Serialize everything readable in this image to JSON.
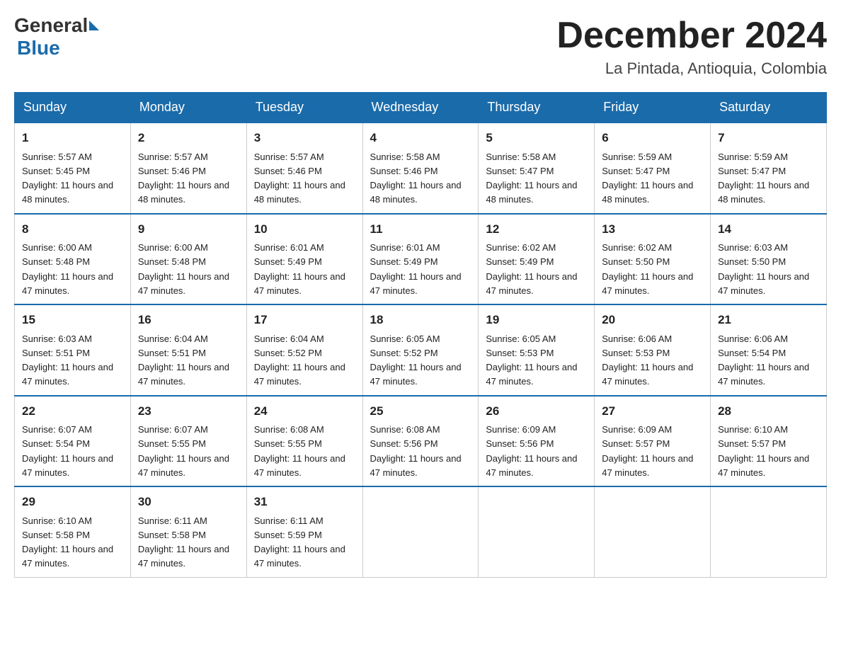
{
  "header": {
    "logo_general": "General",
    "logo_blue": "Blue",
    "month_title": "December 2024",
    "location": "La Pintada, Antioquia, Colombia"
  },
  "days_of_week": [
    "Sunday",
    "Monday",
    "Tuesday",
    "Wednesday",
    "Thursday",
    "Friday",
    "Saturday"
  ],
  "weeks": [
    [
      {
        "day": "1",
        "sunrise": "Sunrise: 5:57 AM",
        "sunset": "Sunset: 5:45 PM",
        "daylight": "Daylight: 11 hours and 48 minutes."
      },
      {
        "day": "2",
        "sunrise": "Sunrise: 5:57 AM",
        "sunset": "Sunset: 5:46 PM",
        "daylight": "Daylight: 11 hours and 48 minutes."
      },
      {
        "day": "3",
        "sunrise": "Sunrise: 5:57 AM",
        "sunset": "Sunset: 5:46 PM",
        "daylight": "Daylight: 11 hours and 48 minutes."
      },
      {
        "day": "4",
        "sunrise": "Sunrise: 5:58 AM",
        "sunset": "Sunset: 5:46 PM",
        "daylight": "Daylight: 11 hours and 48 minutes."
      },
      {
        "day": "5",
        "sunrise": "Sunrise: 5:58 AM",
        "sunset": "Sunset: 5:47 PM",
        "daylight": "Daylight: 11 hours and 48 minutes."
      },
      {
        "day": "6",
        "sunrise": "Sunrise: 5:59 AM",
        "sunset": "Sunset: 5:47 PM",
        "daylight": "Daylight: 11 hours and 48 minutes."
      },
      {
        "day": "7",
        "sunrise": "Sunrise: 5:59 AM",
        "sunset": "Sunset: 5:47 PM",
        "daylight": "Daylight: 11 hours and 48 minutes."
      }
    ],
    [
      {
        "day": "8",
        "sunrise": "Sunrise: 6:00 AM",
        "sunset": "Sunset: 5:48 PM",
        "daylight": "Daylight: 11 hours and 47 minutes."
      },
      {
        "day": "9",
        "sunrise": "Sunrise: 6:00 AM",
        "sunset": "Sunset: 5:48 PM",
        "daylight": "Daylight: 11 hours and 47 minutes."
      },
      {
        "day": "10",
        "sunrise": "Sunrise: 6:01 AM",
        "sunset": "Sunset: 5:49 PM",
        "daylight": "Daylight: 11 hours and 47 minutes."
      },
      {
        "day": "11",
        "sunrise": "Sunrise: 6:01 AM",
        "sunset": "Sunset: 5:49 PM",
        "daylight": "Daylight: 11 hours and 47 minutes."
      },
      {
        "day": "12",
        "sunrise": "Sunrise: 6:02 AM",
        "sunset": "Sunset: 5:49 PM",
        "daylight": "Daylight: 11 hours and 47 minutes."
      },
      {
        "day": "13",
        "sunrise": "Sunrise: 6:02 AM",
        "sunset": "Sunset: 5:50 PM",
        "daylight": "Daylight: 11 hours and 47 minutes."
      },
      {
        "day": "14",
        "sunrise": "Sunrise: 6:03 AM",
        "sunset": "Sunset: 5:50 PM",
        "daylight": "Daylight: 11 hours and 47 minutes."
      }
    ],
    [
      {
        "day": "15",
        "sunrise": "Sunrise: 6:03 AM",
        "sunset": "Sunset: 5:51 PM",
        "daylight": "Daylight: 11 hours and 47 minutes."
      },
      {
        "day": "16",
        "sunrise": "Sunrise: 6:04 AM",
        "sunset": "Sunset: 5:51 PM",
        "daylight": "Daylight: 11 hours and 47 minutes."
      },
      {
        "day": "17",
        "sunrise": "Sunrise: 6:04 AM",
        "sunset": "Sunset: 5:52 PM",
        "daylight": "Daylight: 11 hours and 47 minutes."
      },
      {
        "day": "18",
        "sunrise": "Sunrise: 6:05 AM",
        "sunset": "Sunset: 5:52 PM",
        "daylight": "Daylight: 11 hours and 47 minutes."
      },
      {
        "day": "19",
        "sunrise": "Sunrise: 6:05 AM",
        "sunset": "Sunset: 5:53 PM",
        "daylight": "Daylight: 11 hours and 47 minutes."
      },
      {
        "day": "20",
        "sunrise": "Sunrise: 6:06 AM",
        "sunset": "Sunset: 5:53 PM",
        "daylight": "Daylight: 11 hours and 47 minutes."
      },
      {
        "day": "21",
        "sunrise": "Sunrise: 6:06 AM",
        "sunset": "Sunset: 5:54 PM",
        "daylight": "Daylight: 11 hours and 47 minutes."
      }
    ],
    [
      {
        "day": "22",
        "sunrise": "Sunrise: 6:07 AM",
        "sunset": "Sunset: 5:54 PM",
        "daylight": "Daylight: 11 hours and 47 minutes."
      },
      {
        "day": "23",
        "sunrise": "Sunrise: 6:07 AM",
        "sunset": "Sunset: 5:55 PM",
        "daylight": "Daylight: 11 hours and 47 minutes."
      },
      {
        "day": "24",
        "sunrise": "Sunrise: 6:08 AM",
        "sunset": "Sunset: 5:55 PM",
        "daylight": "Daylight: 11 hours and 47 minutes."
      },
      {
        "day": "25",
        "sunrise": "Sunrise: 6:08 AM",
        "sunset": "Sunset: 5:56 PM",
        "daylight": "Daylight: 11 hours and 47 minutes."
      },
      {
        "day": "26",
        "sunrise": "Sunrise: 6:09 AM",
        "sunset": "Sunset: 5:56 PM",
        "daylight": "Daylight: 11 hours and 47 minutes."
      },
      {
        "day": "27",
        "sunrise": "Sunrise: 6:09 AM",
        "sunset": "Sunset: 5:57 PM",
        "daylight": "Daylight: 11 hours and 47 minutes."
      },
      {
        "day": "28",
        "sunrise": "Sunrise: 6:10 AM",
        "sunset": "Sunset: 5:57 PM",
        "daylight": "Daylight: 11 hours and 47 minutes."
      }
    ],
    [
      {
        "day": "29",
        "sunrise": "Sunrise: 6:10 AM",
        "sunset": "Sunset: 5:58 PM",
        "daylight": "Daylight: 11 hours and 47 minutes."
      },
      {
        "day": "30",
        "sunrise": "Sunrise: 6:11 AM",
        "sunset": "Sunset: 5:58 PM",
        "daylight": "Daylight: 11 hours and 47 minutes."
      },
      {
        "day": "31",
        "sunrise": "Sunrise: 6:11 AM",
        "sunset": "Sunset: 5:59 PM",
        "daylight": "Daylight: 11 hours and 47 minutes."
      },
      null,
      null,
      null,
      null
    ]
  ]
}
